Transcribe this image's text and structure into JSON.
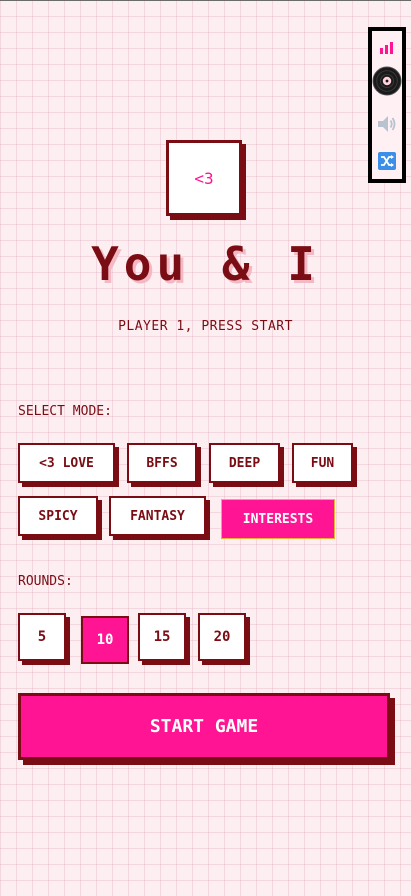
{
  "side_panel": {
    "icons": [
      "bar-chart-icon",
      "vinyl-record-icon",
      "speaker-icon",
      "shuffle-icon"
    ],
    "accent": "#ff1493"
  },
  "logo": {
    "text": "<3"
  },
  "title": "You & I",
  "subtitle": "PLAYER 1, PRESS START",
  "mode": {
    "label": "SELECT MODE:",
    "options": [
      "<3 LOVE",
      "BFFS",
      "DEEP",
      "FUN",
      "SPICY",
      "FANTASY",
      "INTERESTS"
    ],
    "selected": "INTERESTS"
  },
  "rounds": {
    "label": "ROUNDS:",
    "options": [
      "5",
      "10",
      "15",
      "20"
    ],
    "selected": "10"
  },
  "start_button": "START GAME",
  "colors": {
    "primary": "#ff1493",
    "dark": "#7a0d14",
    "background": "#fdeef2"
  }
}
